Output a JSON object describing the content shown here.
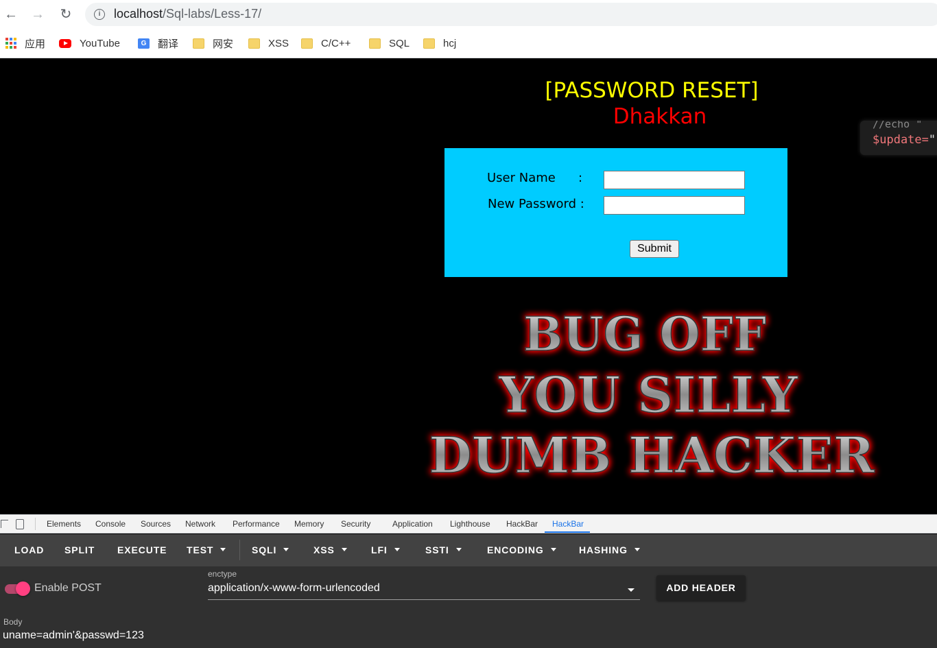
{
  "browser": {
    "url_host": "localhost",
    "url_path": "/Sql-labs/Less-17/",
    "bookmarks": [
      {
        "label": "应用",
        "icon": "apps-grid-icon"
      },
      {
        "label": "YouTube",
        "icon": "youtube-icon"
      },
      {
        "label": "翻译",
        "icon": "google-translate-icon"
      },
      {
        "label": "网安",
        "icon": "folder-icon"
      },
      {
        "label": "XSS",
        "icon": "folder-icon"
      },
      {
        "label": "C/C++",
        "icon": "folder-icon"
      },
      {
        "label": "SQL",
        "icon": "folder-icon"
      },
      {
        "label": "hcj",
        "icon": "folder-icon"
      }
    ]
  },
  "page": {
    "title": "[PASSWORD RESET]",
    "subtitle": "Dhakkan",
    "form": {
      "username_label": "User Name",
      "username_colon": ":",
      "password_label": "New Password :",
      "username_value": "",
      "password_value": "",
      "submit_label": "Submit"
    },
    "code_snippet": {
      "line1": "//echo  \"",
      "line2_var": "$update=",
      "line2_str": "\""
    },
    "banner_text": [
      "BUG OFF",
      "YOU SILLY",
      "DUMB HACKER"
    ]
  },
  "devtools": {
    "tabs": [
      "Elements",
      "Console",
      "Sources",
      "Network",
      "Performance",
      "Memory",
      "Security",
      "Application",
      "Lighthouse",
      "HackBar",
      "HackBar"
    ],
    "active_tab": "HackBar"
  },
  "hackbar": {
    "menu": [
      {
        "label": "LOAD",
        "dropdown": false
      },
      {
        "label": "SPLIT",
        "dropdown": false
      },
      {
        "label": "EXECUTE",
        "dropdown": false
      },
      {
        "label": "TEST",
        "dropdown": true
      },
      {
        "label": "SQLI",
        "dropdown": true
      },
      {
        "label": "XSS",
        "dropdown": true
      },
      {
        "label": "LFI",
        "dropdown": true
      },
      {
        "label": "SSTI",
        "dropdown": true
      },
      {
        "label": "ENCODING",
        "dropdown": true
      },
      {
        "label": "HASHING",
        "dropdown": true
      }
    ],
    "enable_post_label": "Enable POST",
    "enable_post": true,
    "enctype_label": "enctype",
    "enctype_value": "application/x-www-form-urlencoded",
    "add_header_label": "ADD HEADER",
    "body_label": "Body",
    "body_value": "uname=admin'&passwd=123"
  },
  "colors": {
    "title": "#ffff00",
    "subtitle": "#ff0000",
    "form_bg": "#00ccff",
    "toggle_accent": "#ff4081",
    "devtools_active": "#1a73e8"
  }
}
